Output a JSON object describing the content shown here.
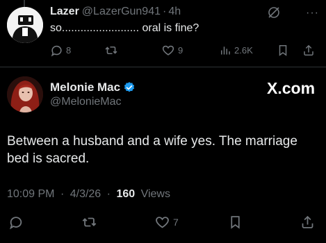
{
  "parent_tweet": {
    "author_name": "Lazer",
    "author_handle": "@LazerGun941",
    "separator": "·",
    "timestamp": "4h",
    "text": "so......................... oral is fine?",
    "more_glyph": "···",
    "actions": {
      "reply_count": "8",
      "retweet_count": "",
      "like_count": "9",
      "views_count": "2.6K"
    }
  },
  "main_tweet": {
    "author_name": "Melonie Mac",
    "author_handle": "@MelonieMac",
    "verified": true,
    "brand": "X.com",
    "text": "Between a husband and a wife yes. The marriage bed is sacred.",
    "time": "10:09 PM",
    "date": "4/3/26",
    "separator": "·",
    "views_count": "160",
    "views_label": "Views",
    "actions": {
      "like_count": "7"
    }
  },
  "colors": {
    "background": "#000000",
    "primary_text": "#e7e9ea",
    "secondary_text": "#71767b",
    "divider": "#2f3336",
    "verified_blue": "#1d9bf0"
  }
}
